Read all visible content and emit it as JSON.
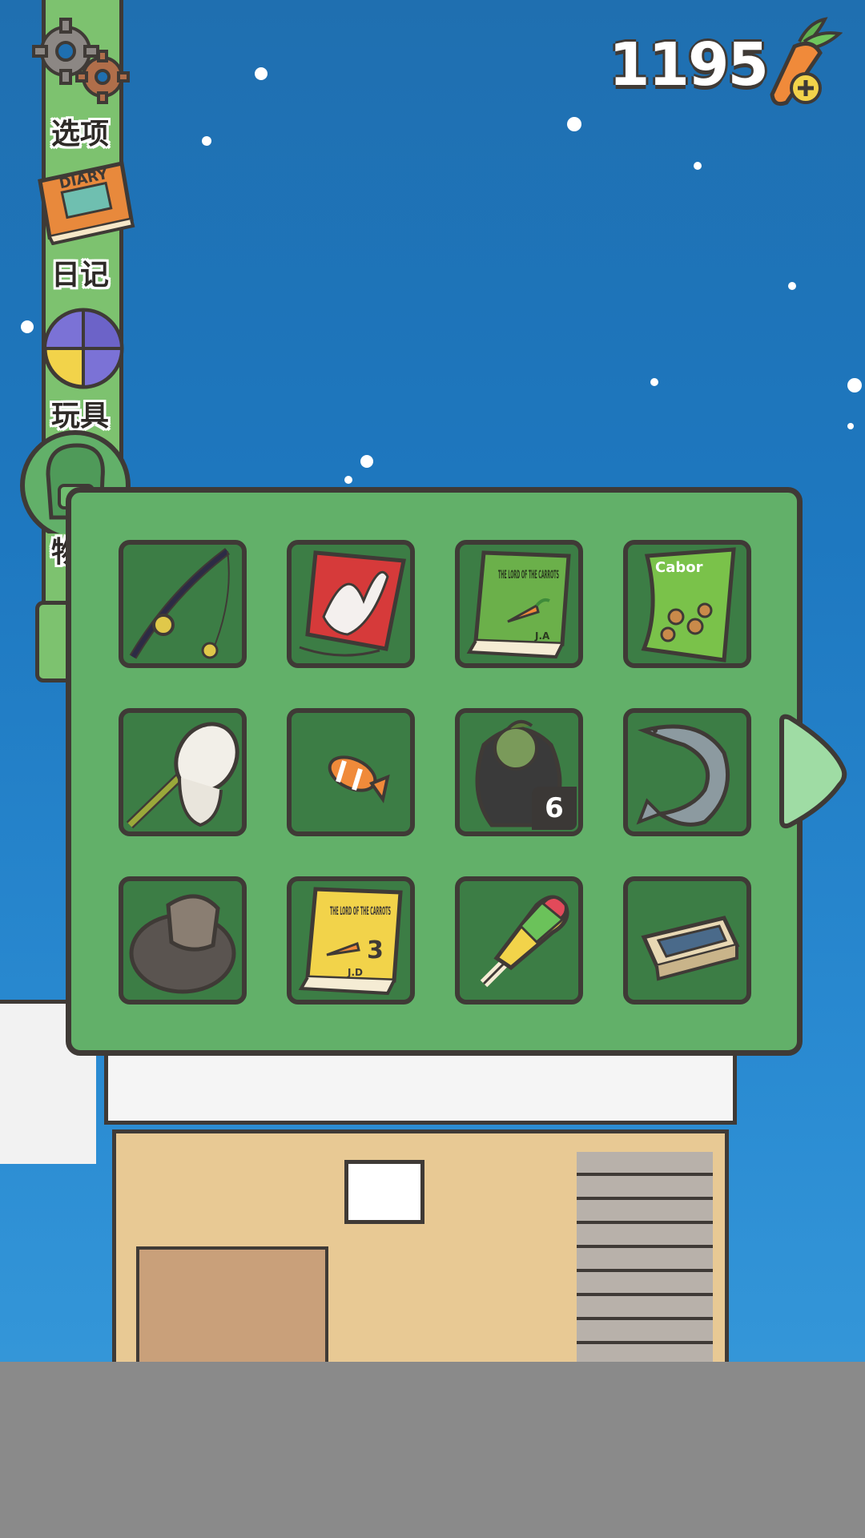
{
  "menu": {
    "items": [
      {
        "label": "选项",
        "icon": "gear-icon"
      },
      {
        "label": "日记",
        "icon": "diary-icon"
      },
      {
        "label": "玩具",
        "icon": "toys-icon"
      },
      {
        "label": "物品",
        "icon": "backpack-icon"
      }
    ]
  },
  "currency": {
    "amount": "1195",
    "icon": "carrot-plus-icon"
  },
  "inventory": {
    "items": [
      {
        "name": "fishing-rod"
      },
      {
        "name": "kite"
      },
      {
        "name": "lord-of-the-carrots-book"
      },
      {
        "name": "snack-bag"
      },
      {
        "name": "bug-net"
      },
      {
        "name": "clownfish"
      },
      {
        "name": "turnip-bag",
        "count": "6"
      },
      {
        "name": "sturgeon"
      },
      {
        "name": "straw-hat"
      },
      {
        "name": "lord-of-the-carrots-book-3"
      },
      {
        "name": "popsicle"
      },
      {
        "name": "bento-box"
      }
    ],
    "book1_title": "THE LORD OF THE CARROTS",
    "book1_author": "J.A",
    "book3_number": "3",
    "book3_author": "J.D",
    "snack_brand": "Cabor"
  },
  "colors": {
    "sky": "#1e78c0",
    "panel": "#62b069",
    "slot": "#3c7d45",
    "outline": "#3f3a36",
    "rail": "#7dc26f"
  }
}
